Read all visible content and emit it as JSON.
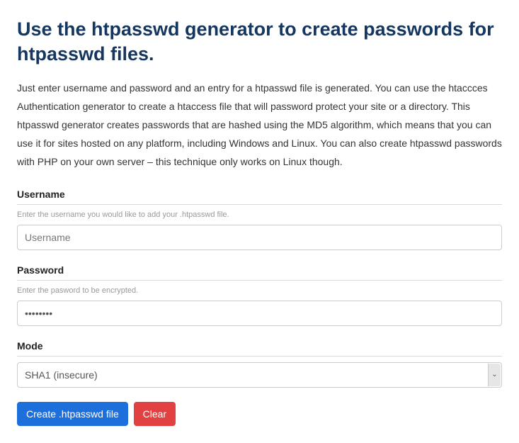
{
  "title": "Use the htpasswd generator to create passwords for htpasswd files.",
  "intro": "Just enter username and password and an entry for a htpasswd file is generated. You can use the htaccces Authentication generator to create a htaccess file that will password protect your site or a directory. This htpasswd generator creates passwords that are hashed using the MD5 algorithm, which means that you can use it for sites hosted on any platform, including Windows and Linux. You can also create htpasswd passwords with PHP on your own server – this technique only works on Linux though.",
  "fields": {
    "username": {
      "label": "Username",
      "help": "Enter the username you would like to add your .htpasswd file.",
      "placeholder": "Username",
      "value": ""
    },
    "password": {
      "label": "Password",
      "help": "Enter the pasword to be encrypted.",
      "value": "••••••••"
    },
    "mode": {
      "label": "Mode",
      "selected": "SHA1 (insecure)"
    }
  },
  "buttons": {
    "create": "Create .htpasswd file",
    "clear": "Clear"
  }
}
